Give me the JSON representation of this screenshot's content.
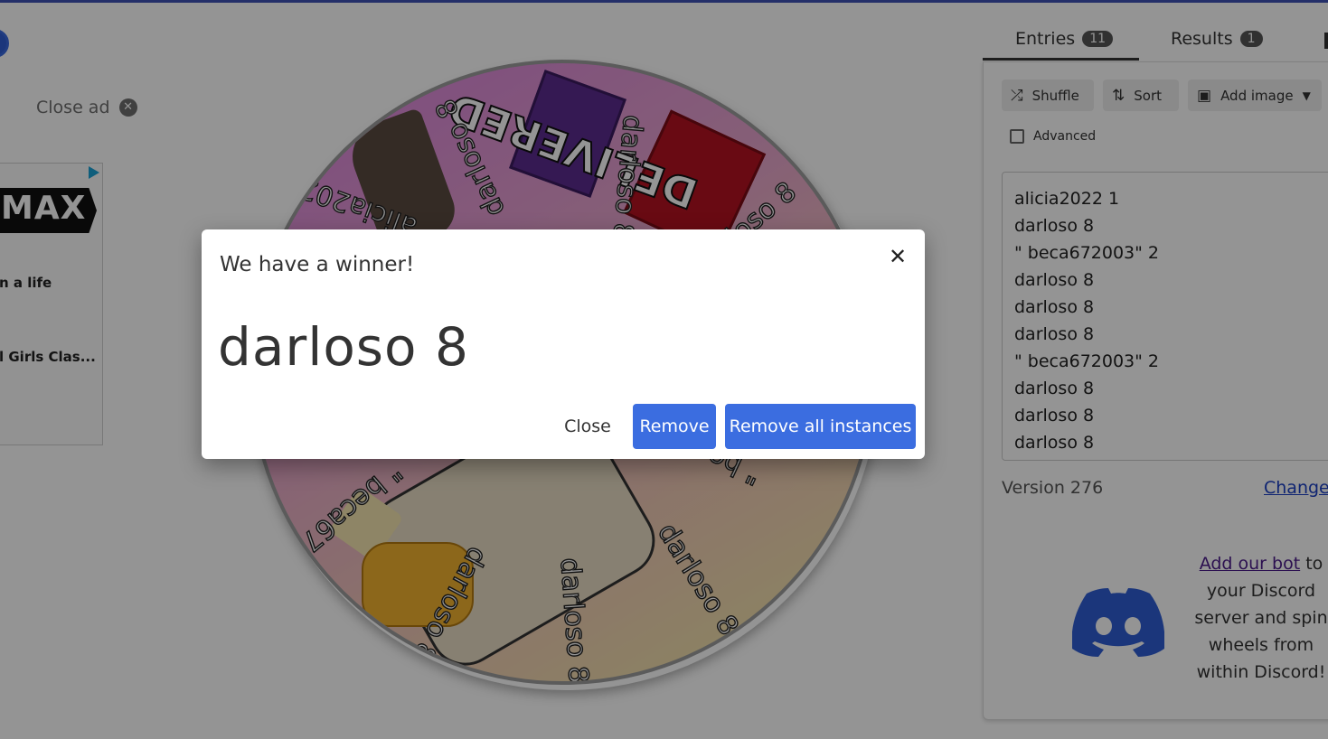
{
  "ad": {
    "close_label": "Close ad",
    "close_icon": "close-circle-icon",
    "banner_text": "MAX",
    "line1": "n a life",
    "line2": "l Girls Clas..."
  },
  "wheel": {
    "labels": [
      "darloso 8",
      "darloso 8",
      "darloso 8",
      "darloso 8",
      "darloso 8",
      "darloso 8",
      "darloso 8",
      "alicia2022 1",
      "\" beca672003\" 2",
      "\" beca672003\" 2"
    ],
    "image_text": "DELIVERED"
  },
  "tabs": {
    "entries_label": "Entries",
    "entries_count": "11",
    "results_label": "Results",
    "results_count": "1"
  },
  "toolbar": {
    "shuffle_label": "Shuffle",
    "sort_label": "Sort",
    "add_image_label": "Add image"
  },
  "advanced_label": "Advanced",
  "entries": [
    "alicia2022 1",
    "darloso 8",
    "\" beca672003\" 2",
    "darloso 8",
    "darloso 8",
    "darloso 8",
    "\" beca672003\" 2",
    "darloso 8",
    "darloso 8",
    "darloso 8"
  ],
  "footer": {
    "version": "Version 276",
    "changelog": "Changel"
  },
  "discord": {
    "link_text": "Add our bot",
    "text": "to your Discord server and spin wheels from within Discord!"
  },
  "dialog": {
    "title": "We have a winner!",
    "winner": "darloso 8",
    "close_label": "Close",
    "remove_label": "Remove",
    "remove_all_label": "Remove all instances"
  },
  "colors": {
    "accent": "#3b6de0",
    "top_bar": "#3f51b5",
    "discord": "#2f5ed4"
  }
}
